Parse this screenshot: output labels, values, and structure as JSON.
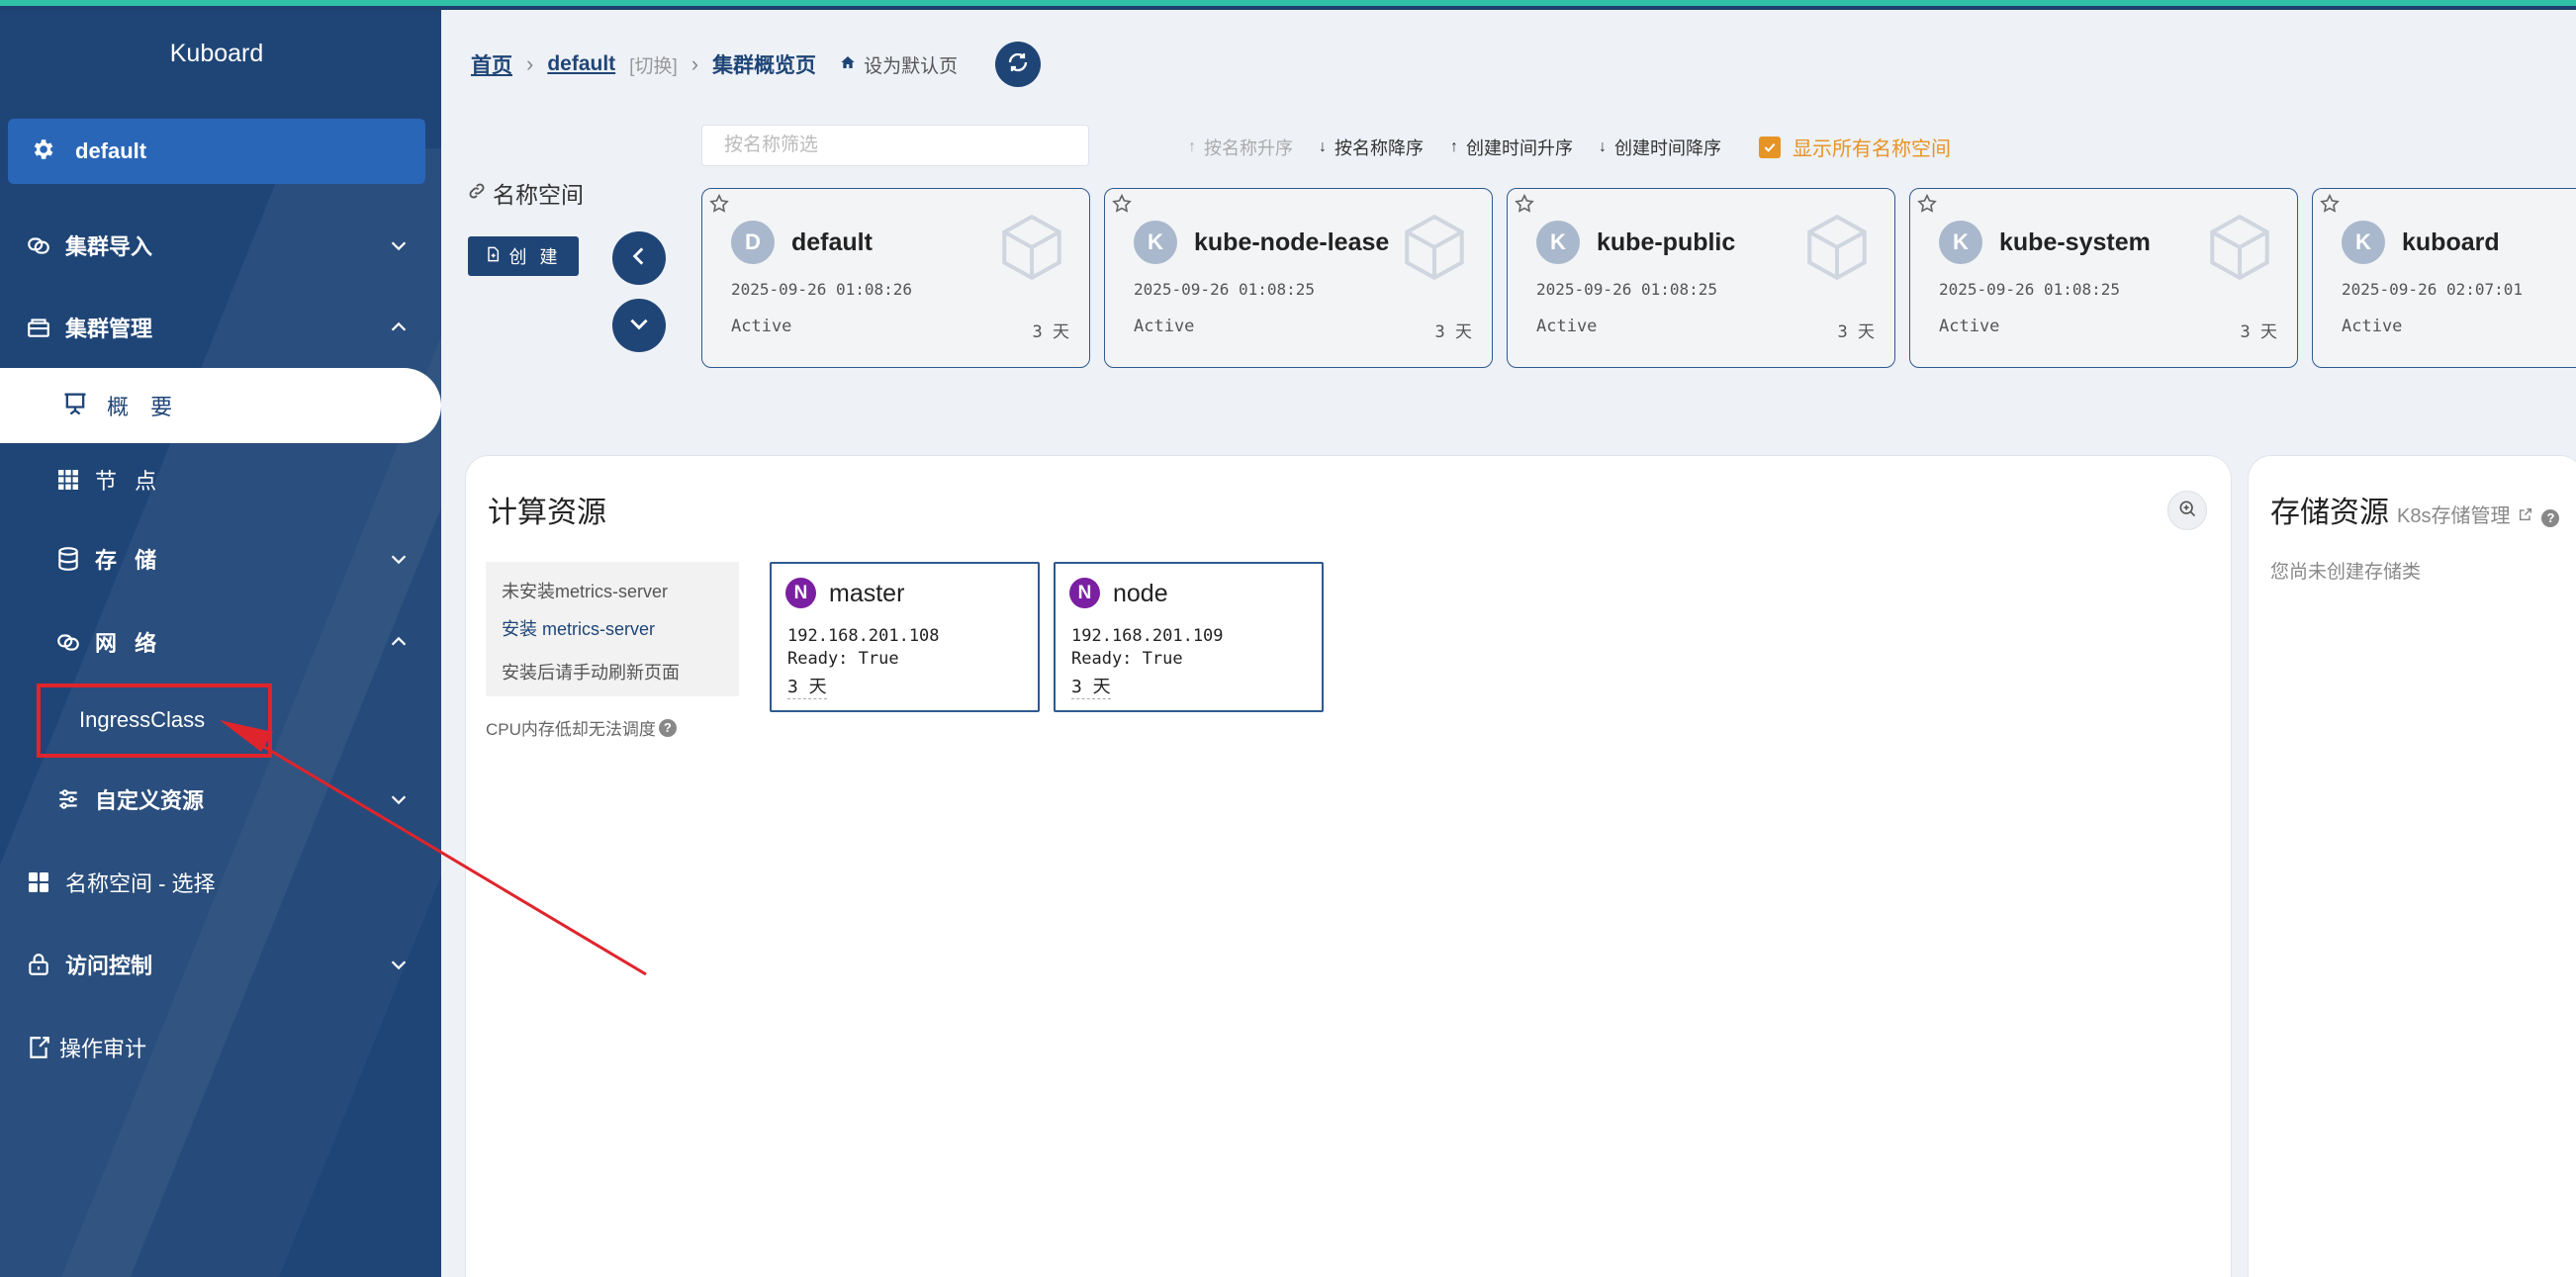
{
  "app": {
    "brand": "Kuboard"
  },
  "colors": {
    "sidebar_bg": "#1f4577",
    "accent": "#e69426",
    "node_badge": "#7b1fa2",
    "annotation_red": "#e0242c"
  },
  "sidebar": {
    "namespace": "default",
    "items": [
      {
        "label": "集群导入",
        "icon": "stack-icon",
        "expanded": false
      },
      {
        "label": "集群管理",
        "icon": "server-icon",
        "expanded": true
      },
      {
        "label": "概 要",
        "icon": "presentation-icon",
        "active": true
      },
      {
        "label": "节 点",
        "icon": "grid-icon"
      },
      {
        "label": "存 储",
        "icon": "database-icon",
        "expanded": false
      },
      {
        "label": "网 络",
        "icon": "network-icon",
        "expanded": true
      },
      {
        "label": "IngressClass",
        "icon": "",
        "highlighted": true
      },
      {
        "label": "自定义资源",
        "icon": "sliders-icon",
        "expanded": false
      },
      {
        "label": "名称空间 - 选择",
        "icon": "apps-icon"
      },
      {
        "label": "访问控制",
        "icon": "lock-icon",
        "expanded": false
      },
      {
        "label": "操作审计",
        "icon": "audit-icon"
      }
    ]
  },
  "breadcrumb": {
    "home": "首页",
    "cluster": "default",
    "switch": "[切换]",
    "current": "集群概览页",
    "set_default": "设为默认页"
  },
  "namespaces": {
    "title": "名称空间",
    "create_label": "创 建",
    "filter_placeholder": "按名称筛选",
    "sort": {
      "name_asc": "按名称升序",
      "name_desc": "按名称降序",
      "time_asc": "创建时间升序",
      "time_desc": "创建时间降序"
    },
    "show_all": "显示所有名称空间",
    "cards": [
      {
        "letter": "D",
        "name": "default",
        "time": "2025-09-26 01:08:26",
        "status": "Active",
        "age": "3 天"
      },
      {
        "letter": "K",
        "name": "kube-node-lease",
        "time": "2025-09-26 01:08:25",
        "status": "Active",
        "age": "3 天"
      },
      {
        "letter": "K",
        "name": "kube-public",
        "time": "2025-09-26 01:08:25",
        "status": "Active",
        "age": "3 天"
      },
      {
        "letter": "K",
        "name": "kube-system",
        "time": "2025-09-26 01:08:25",
        "status": "Active",
        "age": "3 天"
      },
      {
        "letter": "K",
        "name": "kuboard",
        "time": "2025-09-26 02:07:01",
        "status": "Active",
        "age": ""
      }
    ]
  },
  "compute": {
    "title": "计算资源",
    "metrics_not_installed": "未安装metrics-server",
    "metrics_install": "安装 metrics-server",
    "metrics_refresh": "安装后请手动刷新页面",
    "cpu_note": "CPU内存低却无法调度",
    "nodes": [
      {
        "badge": "N",
        "name": "master",
        "ip": "192.168.201.108",
        "ready": "Ready: True",
        "age": "3 天"
      },
      {
        "badge": "N",
        "name": "node",
        "ip": "192.168.201.109",
        "ready": "Ready: True",
        "age": "3 天"
      }
    ]
  },
  "storage": {
    "title": "存储资源",
    "link": "K8s存储管理",
    "empty": "您尚未创建存储类"
  }
}
